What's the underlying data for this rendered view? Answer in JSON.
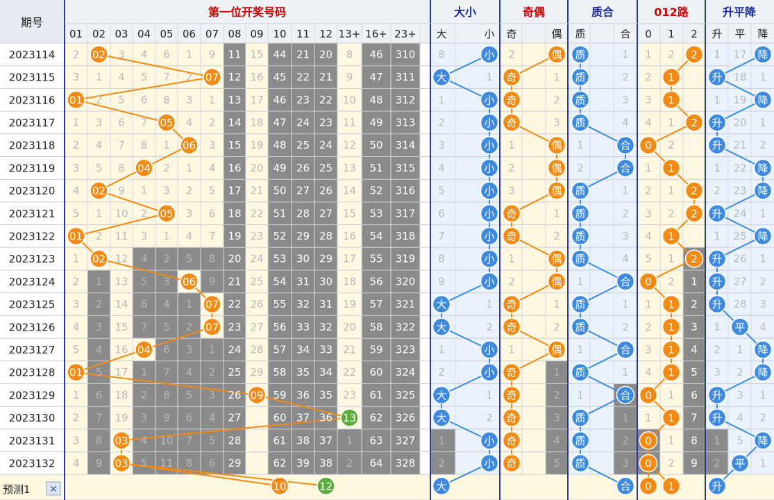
{
  "header": {
    "period_label": "期号",
    "group_titles": [
      "第一位开奖号码",
      "大小",
      "奇偶",
      "质合",
      "012路",
      "升平降"
    ],
    "num_cols": [
      "01",
      "02",
      "03",
      "04",
      "05",
      "06",
      "07",
      "08",
      "09",
      "10",
      "11",
      "12",
      "13+",
      "16+",
      "23+"
    ],
    "bs_cols": [
      "大",
      "小"
    ],
    "oe_cols": [
      "奇",
      "偶"
    ],
    "pc_cols": [
      "质",
      "合"
    ],
    "r_cols": [
      "0",
      "1",
      "2"
    ],
    "t_cols": [
      "升",
      "平",
      "降"
    ]
  },
  "glyphs": {
    "big": "大",
    "small": "小",
    "odd": "奇",
    "even": "偶",
    "prime": "质",
    "composite": "合",
    "up": "升",
    "flat": "平",
    "down": "降"
  },
  "colors": {
    "header_red": "#cc0000",
    "header_blue": "#1a2a9a",
    "orange": "#f28a14",
    "blue": "#3d8ae0",
    "green": "#5cae3c",
    "gray_block": "#8a8a8a"
  },
  "prediction": {
    "label": "预测1",
    "close_icon": "✕"
  },
  "chart_data": {
    "type": "table",
    "title": "第一位开奖号码",
    "periods": [
      "2023114",
      "2023115",
      "2023116",
      "2023117",
      "2023118",
      "2023119",
      "2023120",
      "2023121",
      "2023122",
      "2023123",
      "2023124",
      "2023125",
      "2023126",
      "2023127",
      "2023128",
      "2023129",
      "2023130",
      "2023131",
      "2023132"
    ],
    "first_number": [
      2,
      7,
      1,
      5,
      6,
      4,
      2,
      5,
      1,
      2,
      6,
      7,
      7,
      4,
      1,
      9,
      13,
      3,
      3
    ],
    "cells": [
      [
        "2",
        "02",
        "3",
        "4",
        "6",
        "1",
        "9",
        "11",
        "15",
        "44",
        "21",
        "20",
        "8",
        "46",
        "310"
      ],
      [
        "3",
        "1",
        "4",
        "5",
        "7",
        "2",
        "07",
        "12",
        "16",
        "45",
        "22",
        "21",
        "9",
        "47",
        "311"
      ],
      [
        "01",
        "2",
        "5",
        "6",
        "8",
        "3",
        "1",
        "13",
        "17",
        "46",
        "23",
        "22",
        "10",
        "48",
        "312"
      ],
      [
        "1",
        "3",
        "6",
        "7",
        "05",
        "4",
        "2",
        "14",
        "18",
        "47",
        "24",
        "23",
        "11",
        "49",
        "313"
      ],
      [
        "2",
        "4",
        "7",
        "8",
        "1",
        "06",
        "3",
        "15",
        "19",
        "48",
        "25",
        "24",
        "12",
        "50",
        "314"
      ],
      [
        "3",
        "5",
        "8",
        "04",
        "2",
        "1",
        "4",
        "16",
        "20",
        "49",
        "26",
        "25",
        "13",
        "51",
        "315"
      ],
      [
        "4",
        "02",
        "9",
        "1",
        "3",
        "2",
        "5",
        "17",
        "21",
        "50",
        "27",
        "26",
        "14",
        "52",
        "316"
      ],
      [
        "5",
        "1",
        "10",
        "2",
        "05",
        "3",
        "6",
        "18",
        "22",
        "51",
        "28",
        "27",
        "15",
        "53",
        "317"
      ],
      [
        "01",
        "2",
        "11",
        "3",
        "1",
        "4",
        "7",
        "19",
        "23",
        "52",
        "29",
        "28",
        "16",
        "54",
        "318"
      ],
      [
        "1",
        "02",
        "12",
        "4",
        "2",
        "5",
        "8",
        "20",
        "24",
        "53",
        "30",
        "29",
        "17",
        "55",
        "319"
      ],
      [
        "2",
        "1",
        "13",
        "5",
        "3",
        "06",
        "9",
        "21",
        "25",
        "54",
        "31",
        "30",
        "18",
        "56",
        "320"
      ],
      [
        "3",
        "2",
        "14",
        "6",
        "4",
        "1",
        "07",
        "22",
        "26",
        "55",
        "32",
        "31",
        "19",
        "57",
        "321"
      ],
      [
        "4",
        "3",
        "15",
        "7",
        "5",
        "2",
        "07",
        "23",
        "27",
        "56",
        "33",
        "32",
        "20",
        "58",
        "322"
      ],
      [
        "5",
        "4",
        "16",
        "04",
        "6",
        "3",
        "1",
        "24",
        "28",
        "57",
        "34",
        "33",
        "21",
        "59",
        "323"
      ],
      [
        "01",
        "5",
        "17",
        "1",
        "7",
        "4",
        "2",
        "25",
        "29",
        "58",
        "35",
        "34",
        "22",
        "60",
        "324"
      ],
      [
        "1",
        "6",
        "18",
        "2",
        "8",
        "5",
        "3",
        "26",
        "09",
        "59",
        "36",
        "35",
        "23",
        "61",
        "325"
      ],
      [
        "2",
        "7",
        "19",
        "3",
        "9",
        "6",
        "4",
        "27",
        "1",
        "60",
        "37",
        "36",
        "13",
        "62",
        "326"
      ],
      [
        "3",
        "8",
        "03",
        "4",
        "10",
        "7",
        "5",
        "28",
        "2",
        "61",
        "38",
        "37",
        "1",
        "63",
        "327"
      ],
      [
        "4",
        "9",
        "03",
        "5",
        "11",
        "8",
        "6",
        "29",
        "3",
        "62",
        "39",
        "38",
        "2",
        "64",
        "328"
      ]
    ],
    "bs": [
      [
        "8",
        "小"
      ],
      [
        "大",
        "1"
      ],
      [
        "1",
        "小"
      ],
      [
        "2",
        "小"
      ],
      [
        "3",
        "小"
      ],
      [
        "4",
        "小"
      ],
      [
        "5",
        "小"
      ],
      [
        "6",
        "小"
      ],
      [
        "7",
        "小"
      ],
      [
        "8",
        "小"
      ],
      [
        "9",
        "小"
      ],
      [
        "大",
        "1"
      ],
      [
        "大",
        "2"
      ],
      [
        "1",
        "小"
      ],
      [
        "2",
        "小"
      ],
      [
        "大",
        "1"
      ],
      [
        "大",
        "2"
      ],
      [
        "1",
        "小"
      ],
      [
        "2",
        "小"
      ]
    ],
    "oe": [
      [
        "2",
        "偶"
      ],
      [
        "奇",
        "1"
      ],
      [
        "奇",
        "2"
      ],
      [
        "奇",
        "3"
      ],
      [
        "1",
        "偶"
      ],
      [
        "2",
        "偶"
      ],
      [
        "3",
        "偶"
      ],
      [
        "奇",
        "1"
      ],
      [
        "奇",
        "2"
      ],
      [
        "1",
        "偶"
      ],
      [
        "2",
        "偶"
      ],
      [
        "奇",
        "1"
      ],
      [
        "奇",
        "2"
      ],
      [
        "1",
        "偶"
      ],
      [
        "奇",
        "1"
      ],
      [
        "奇",
        "2"
      ],
      [
        "奇",
        "3"
      ],
      [
        "奇",
        "4"
      ],
      [
        "奇",
        "5"
      ]
    ],
    "pc": [
      [
        "质",
        "1"
      ],
      [
        "质",
        "2"
      ],
      [
        "质",
        "3"
      ],
      [
        "质",
        "4"
      ],
      [
        "1",
        "合"
      ],
      [
        "2",
        "合"
      ],
      [
        "质",
        "1"
      ],
      [
        "质",
        "2"
      ],
      [
        "质",
        "3"
      ],
      [
        "质",
        "4"
      ],
      [
        "1",
        "合"
      ],
      [
        "质",
        "1"
      ],
      [
        "质",
        "2"
      ],
      [
        "1",
        "合"
      ],
      [
        "质",
        "1"
      ],
      [
        "1",
        "合"
      ],
      [
        "质",
        "1"
      ],
      [
        "质",
        "2"
      ],
      [
        "质",
        "3"
      ]
    ],
    "r": [
      [
        "1",
        "2",
        "2"
      ],
      [
        "2",
        "1",
        "1"
      ],
      [
        "3",
        "1",
        "2"
      ],
      [
        "4",
        "1",
        "2"
      ],
      [
        "0",
        "2",
        "1"
      ],
      [
        "1",
        "1",
        "2"
      ],
      [
        "2",
        "1",
        "2"
      ],
      [
        "3",
        "2",
        "2"
      ],
      [
        "4",
        "1",
        "1"
      ],
      [
        "5",
        "1",
        "2"
      ],
      [
        "0",
        "2",
        "1"
      ],
      [
        "1",
        "1",
        "2"
      ],
      [
        "2",
        "1",
        "3"
      ],
      [
        "3",
        "1",
        "4"
      ],
      [
        "4",
        "1",
        "5"
      ],
      [
        "0",
        "1",
        "6"
      ],
      [
        "1",
        "1",
        "7"
      ],
      [
        "0",
        "1",
        "8"
      ],
      [
        "0",
        "2",
        "9"
      ]
    ],
    "t": [
      [
        "1",
        "17",
        "降"
      ],
      [
        "升",
        "18",
        "1"
      ],
      [
        "1",
        "19",
        "降"
      ],
      [
        "升",
        "20",
        "1"
      ],
      [
        "升",
        "21",
        "2"
      ],
      [
        "1",
        "22",
        "降"
      ],
      [
        "2",
        "23",
        "降"
      ],
      [
        "升",
        "24",
        "1"
      ],
      [
        "1",
        "25",
        "降"
      ],
      [
        "升",
        "26",
        "1"
      ],
      [
        "升",
        "27",
        "2"
      ],
      [
        "升",
        "28",
        "3"
      ],
      [
        "1",
        "平",
        "4"
      ],
      [
        "2",
        "1",
        "降"
      ],
      [
        "3",
        "2",
        "降"
      ],
      [
        "升",
        "3",
        "1"
      ],
      [
        "升",
        "4",
        "2"
      ],
      [
        "1",
        "5",
        "降"
      ],
      [
        "2",
        "平",
        "1"
      ]
    ],
    "prediction_row": {
      "numbers": [
        "10",
        "12"
      ],
      "bs": "大",
      "pc": "合",
      "r": [
        "0",
        "1"
      ],
      "t": "升"
    }
  }
}
